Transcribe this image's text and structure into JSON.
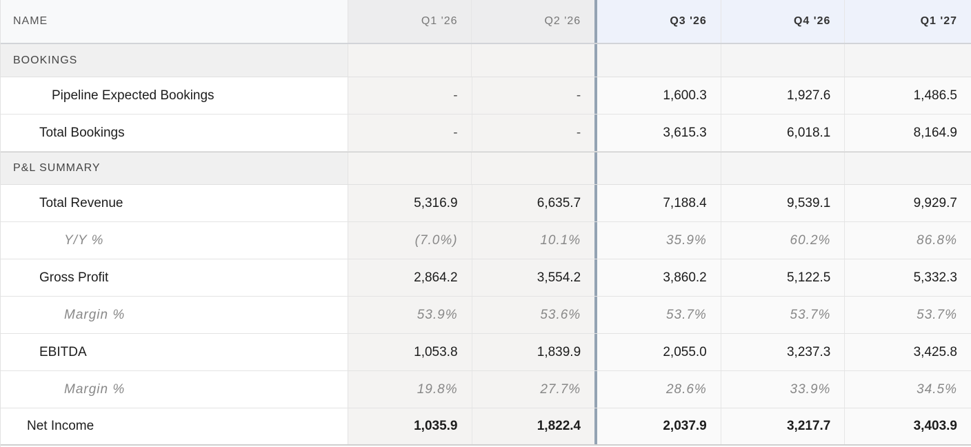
{
  "columns": {
    "name": "NAME",
    "periods": [
      "Q1 '26",
      "Q2 '26",
      "Q3 '26",
      "Q4 '26",
      "Q1 '27"
    ]
  },
  "sections": {
    "bookings": "BOOKINGS",
    "pl_summary": "P&L SUMMARY"
  },
  "rows": {
    "pipeline": {
      "label": "Pipeline Expected Bookings",
      "values": [
        "-",
        "-",
        "1,600.3",
        "1,927.6",
        "1,486.5"
      ]
    },
    "total_bookings": {
      "label": "Total Bookings",
      "values": [
        "-",
        "-",
        "3,615.3",
        "6,018.1",
        "8,164.9"
      ]
    },
    "total_revenue": {
      "label": "Total Revenue",
      "values": [
        "5,316.9",
        "6,635.7",
        "7,188.4",
        "9,539.1",
        "9,929.7"
      ]
    },
    "yoy": {
      "label": "Y/Y %",
      "values": [
        "(7.0%)",
        "10.1%",
        "35.9%",
        "60.2%",
        "86.8%"
      ]
    },
    "gross_profit": {
      "label": "Gross Profit",
      "values": [
        "2,864.2",
        "3,554.2",
        "3,860.2",
        "5,122.5",
        "5,332.3"
      ]
    },
    "gp_margin": {
      "label": "Margin %",
      "values": [
        "53.9%",
        "53.6%",
        "53.7%",
        "53.7%",
        "53.7%"
      ]
    },
    "ebitda": {
      "label": "EBITDA",
      "values": [
        "1,053.8",
        "1,839.9",
        "2,055.0",
        "3,237.3",
        "3,425.8"
      ]
    },
    "ebitda_margin": {
      "label": "Margin %",
      "values": [
        "19.8%",
        "27.7%",
        "28.6%",
        "33.9%",
        "34.5%"
      ]
    },
    "net_income": {
      "label": "Net Income",
      "values": [
        "1,035.9",
        "1,822.4",
        "2,037.9",
        "3,217.7",
        "3,403.9"
      ]
    }
  },
  "colors": {
    "forecast_divider": "#94a3b3",
    "historical_bg": "#f4f3f2",
    "forecast_header_bg": "#eef2fb"
  }
}
